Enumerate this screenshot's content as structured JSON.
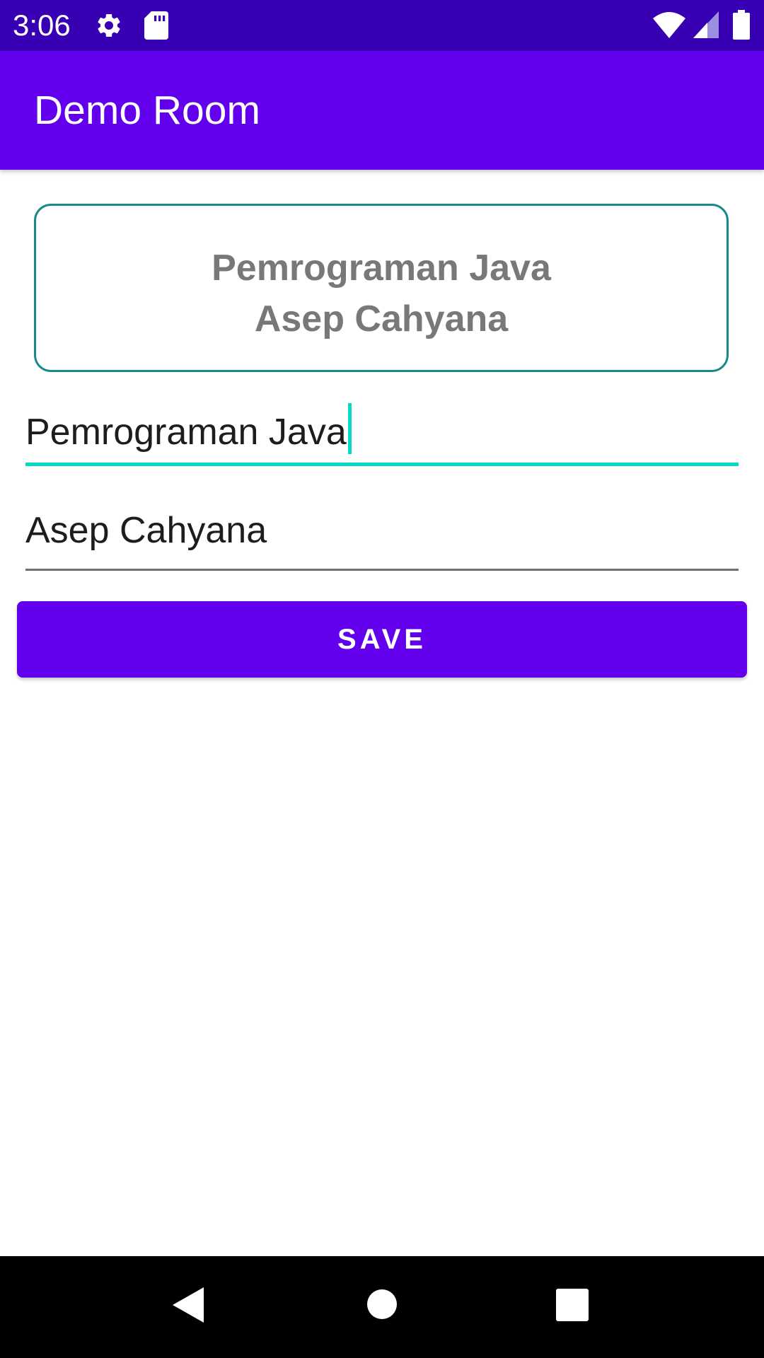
{
  "status_bar": {
    "time": "3:06",
    "icons": [
      "gear-icon",
      "sd-card-icon",
      "wifi-icon",
      "signal-icon",
      "battery-icon"
    ]
  },
  "app_bar": {
    "title": "Demo Room"
  },
  "card": {
    "line1": "Pemrograman Java",
    "line2": "Asep Cahyana"
  },
  "form": {
    "title_value": "Pemrograman Java",
    "author_value": "Asep Cahyana"
  },
  "buttons": {
    "save_label": "SAVE"
  },
  "nav_bar": {
    "icons": [
      "back-icon",
      "home-icon",
      "recents-icon"
    ]
  },
  "colors": {
    "status_bar": "#3700B3",
    "primary": "#6200EE",
    "accent": "#03DAC5",
    "card_border": "#148B88",
    "card_text": "#787878"
  }
}
